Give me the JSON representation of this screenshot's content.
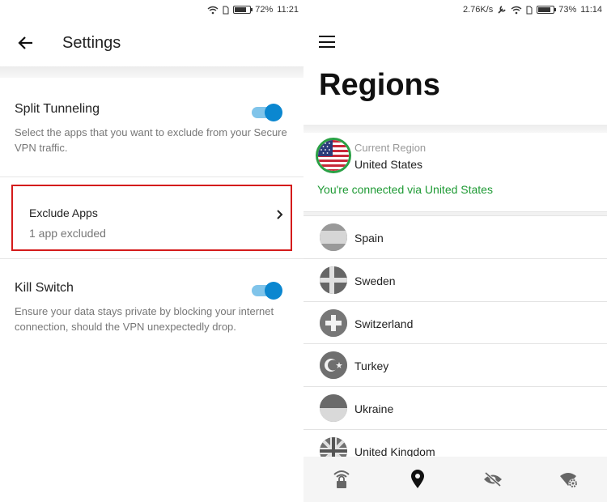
{
  "left": {
    "status": {
      "battery": "72%",
      "time": "11:21"
    },
    "header": {
      "title": "Settings"
    },
    "split_tunneling": {
      "title": "Split Tunneling",
      "description": "Select the apps that you want to exclude from your Secure VPN traffic.",
      "enabled": true
    },
    "exclude_apps": {
      "title": "Exclude Apps",
      "subtitle": "1 app excluded"
    },
    "kill_switch": {
      "title": "Kill Switch",
      "description": "Ensure your data stays private by blocking your internet connection, should the VPN unexpectedly drop.",
      "enabled": true
    }
  },
  "right": {
    "status": {
      "speed": "2.76K/s",
      "battery": "73%",
      "time": "11:14"
    },
    "title": "Regions",
    "current": {
      "label": "Current Region",
      "value": "United States",
      "status": "You're connected via United States"
    },
    "regions": [
      {
        "name": "Spain"
      },
      {
        "name": "Sweden"
      },
      {
        "name": "Switzerland"
      },
      {
        "name": "Turkey"
      },
      {
        "name": "Ukraine"
      },
      {
        "name": "United Kingdom"
      }
    ],
    "bottom_nav": [
      {
        "icon": "wifi-lock-icon",
        "active": false
      },
      {
        "icon": "location-pin-icon",
        "active": true
      },
      {
        "icon": "eye-off-icon",
        "active": false
      },
      {
        "icon": "wifi-settings-icon",
        "active": false
      }
    ]
  },
  "colors": {
    "accent_blue": "#0b87d0",
    "connected_green": "#1e9a34",
    "highlight_red": "#d41b1b"
  }
}
